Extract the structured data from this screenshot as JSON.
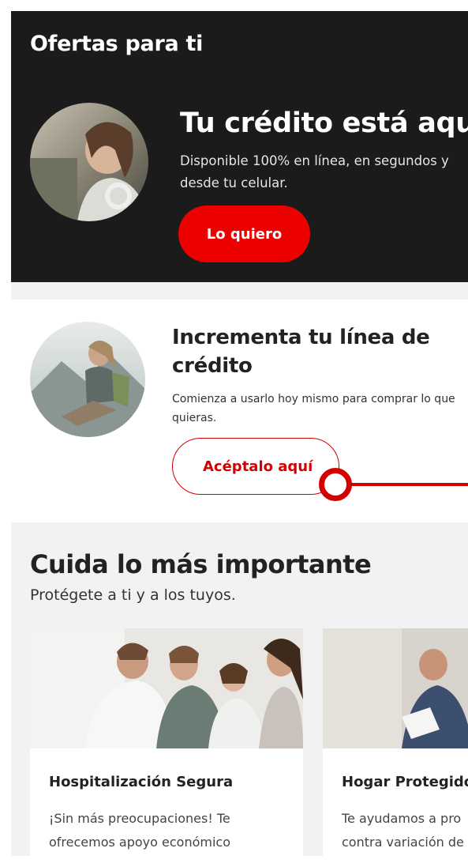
{
  "offers": {
    "section_title": "Ofertas para ti",
    "credit": {
      "title": "Tu crédito está aquí",
      "description": "Disponible 100% en línea, en segundos y desde tu celular.",
      "button_label": "Lo quiero"
    }
  },
  "increment": {
    "title": "Incrementa tu línea de crédito",
    "description": "Comienza a usarlo hoy mismo para comprar lo que quieras.",
    "button_label": "Acéptalo aquí"
  },
  "care": {
    "title": "Cuida lo más importante",
    "subtitle": "Protégete a ti y a los tuyos.",
    "cards": [
      {
        "title": "Hospitalización Segura",
        "description_line1": "¡Sin más preocupaciones! Te",
        "description_line2": "ofrecemos apoyo económico"
      },
      {
        "title": "Hogar Protegido",
        "description_line1": "Te ayudamos a pro",
        "description_line2": "contra variación de"
      }
    ]
  },
  "colors": {
    "brand_red": "#ec0000",
    "dark_bg": "#1b1b1b",
    "page_bg": "#f2f2f2"
  }
}
